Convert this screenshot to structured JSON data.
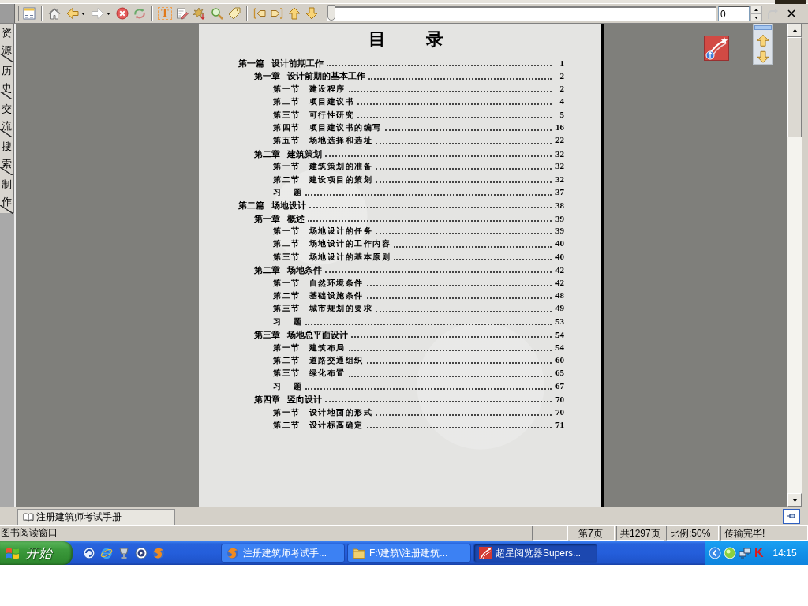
{
  "toolbar": {
    "button_groups": [
      [
        {
          "kind": "catalog",
          "disabled": false
        }
      ],
      [
        {
          "kind": "home",
          "disabled": false
        },
        {
          "kind": "back",
          "disabled": false
        },
        {
          "kind": "forward",
          "disabled": true
        },
        {
          "kind": "stop",
          "disabled": false
        },
        {
          "kind": "refresh",
          "disabled": false
        }
      ],
      [
        {
          "kind": "text",
          "label": "T",
          "disabled": false
        },
        {
          "kind": "annotate",
          "disabled": false
        },
        {
          "kind": "tool",
          "disabled": false
        },
        {
          "kind": "search",
          "disabled": false
        },
        {
          "kind": "bookmark",
          "disabled": false
        }
      ],
      [
        {
          "kind": "prev_mark",
          "disabled": false
        },
        {
          "kind": "next_mark",
          "disabled": false
        },
        {
          "kind": "page_up",
          "disabled": false
        },
        {
          "kind": "page_down",
          "disabled": false
        }
      ]
    ],
    "page_slider": {
      "level": 0
    },
    "page_input": {
      "value": "0"
    },
    "go_button": {
      "disabled": true
    }
  },
  "sidebar": {
    "tabs": [
      {
        "label": "资源"
      },
      {
        "label": "历史"
      },
      {
        "label": "交流"
      },
      {
        "label": "搜索"
      },
      {
        "label": "制作"
      }
    ]
  },
  "document": {
    "title": "目 录",
    "entries": [
      {
        "heading": "第一篇",
        "title": "设计前期工作",
        "page": "1",
        "children": [
          {
            "heading": "第一章",
            "title": "设计前期的基本工作",
            "page": "2",
            "children": [
              {
                "heading": "第一节",
                "title": "建设程序",
                "page": "2"
              },
              {
                "heading": "第二节",
                "title": "项目建议书",
                "page": "4"
              },
              {
                "heading": "第三节",
                "title": "可行性研究",
                "page": "5"
              },
              {
                "heading": "第四节",
                "title": "项目建议书的编写",
                "page": "16"
              },
              {
                "heading": "第五节",
                "title": "场地选择和选址",
                "page": "22"
              }
            ]
          },
          {
            "heading": "第二章",
            "title": "建筑策划",
            "page": "32",
            "children": [
              {
                "heading": "第一节",
                "title": "建筑策划的准备",
                "page": "32"
              },
              {
                "heading": "第二节",
                "title": "建设项目的策划",
                "page": "32"
              },
              {
                "title": "习 题",
                "page": "37"
              }
            ]
          }
        ]
      },
      {
        "heading": "第二篇",
        "title": "场地设计",
        "page": "38",
        "children": [
          {
            "heading": "第一章",
            "title": "概述",
            "page": "39",
            "children": [
              {
                "heading": "第一节",
                "title": "场地设计的任务",
                "page": "39"
              },
              {
                "heading": "第二节",
                "title": "场地设计的工作内容",
                "page": "40"
              },
              {
                "heading": "第三节",
                "title": "场地设计的基本原则",
                "page": "40"
              }
            ]
          },
          {
            "heading": "第二章",
            "title": "场地条件",
            "page": "42",
            "children": [
              {
                "heading": "第一节",
                "title": "自然环境条件",
                "page": "42"
              },
              {
                "heading": "第二节",
                "title": "基础设施条件",
                "page": "48"
              },
              {
                "heading": "第三节",
                "title": "城市规划的要求",
                "page": "49"
              },
              {
                "title": "习 题",
                "page": "53"
              }
            ]
          },
          {
            "heading": "第三章",
            "title": "场地总平面设计",
            "page": "54",
            "children": [
              {
                "heading": "第一节",
                "title": "建筑布局",
                "page": "54"
              },
              {
                "heading": "第二节",
                "title": "道路交通组织",
                "page": "60"
              },
              {
                "heading": "第三节",
                "title": "绿化布置",
                "page": "65"
              },
              {
                "title": "习 题",
                "page": "67"
              }
            ]
          },
          {
            "heading": "第四章",
            "title": "竖向设计",
            "page": "70",
            "children": [
              {
                "heading": "第一节",
                "title": "设计地面的形式",
                "page": "70"
              },
              {
                "heading": "第二节",
                "title": "设计标高确定",
                "page": "71"
              }
            ]
          }
        ]
      }
    ]
  },
  "book_tabs": [
    {
      "label": "注册建筑师考试手册",
      "selected": true
    }
  ],
  "status_bar": {
    "text": "图书阅读窗口",
    "panes": [
      "第7页",
      "共1297页",
      "比例:50%",
      "传输完毕!"
    ]
  },
  "taskbar": {
    "start": {
      "label": "开始"
    },
    "tasks": [
      {
        "kind": "browser",
        "label": "注册建筑师考试手...",
        "selected": false
      },
      {
        "kind": "folder",
        "label": "F:\\建筑\\注册建筑...",
        "selected": false
      },
      {
        "kind": "reader",
        "label": "超星阅览器Supers...",
        "selected": true
      }
    ],
    "tray": {
      "letter_icon": "K",
      "clock": "14:15"
    }
  }
}
